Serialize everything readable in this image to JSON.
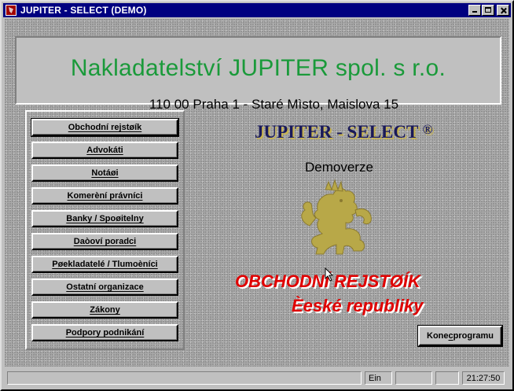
{
  "window": {
    "title": "JUPITER - SELECT (DEMO)"
  },
  "header": {
    "company": "Nakladatelství  JUPITER  spol. s r.o.",
    "address": "110 00 Praha 1 - Staré Mìsto,  Maislova 15"
  },
  "menu": {
    "items": [
      "Obchodní rejstøík",
      "Advokáti",
      "Notáøi",
      "Komerèní právníci",
      "Banky / Spoøitelny",
      "Daòoví poradci",
      "Pøekladatelé  /  Tlumoèníci",
      "Ostatní organizace",
      "Zákony",
      "Podpory podnikání"
    ]
  },
  "main": {
    "app_title": "JUPITER - SELECT",
    "registered_mark": "®",
    "subtitle": "Demoverze",
    "line1": "OBCHODNÍ REJSTØÍK",
    "line2": "Èeské republiky"
  },
  "exit_button": {
    "prefix": "Kone",
    "accel": "c",
    "suffix": " programu"
  },
  "statusbar": {
    "mode": "Ein",
    "clock": "21:27:50"
  },
  "colors": {
    "title_bar": "#000080",
    "company_green": "#1a9a3a",
    "red_text": "#e00000",
    "lion_gold": "#b8a848"
  }
}
